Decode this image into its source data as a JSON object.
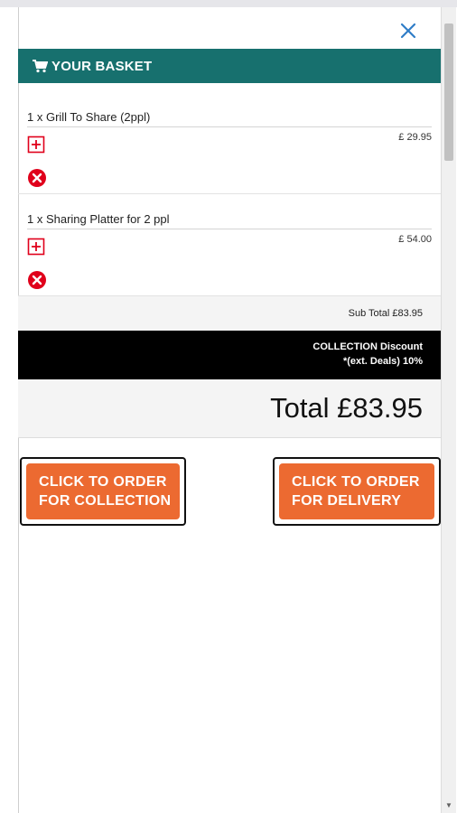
{
  "header": {
    "title": "YOUR BASKET",
    "cart_icon": "cart-icon",
    "close_icon": "close-icon"
  },
  "items": [
    {
      "name": "1 x Grill To Share (2ppl)",
      "price": "£ 29.95"
    },
    {
      "name": "1 x Sharing Platter for 2 ppl",
      "price": "£ 54.00"
    }
  ],
  "summary": {
    "subtotal": "Sub Total £83.95",
    "discount_line1": "COLLECTION Discount",
    "discount_line2": "*(ext. Deals) 10%",
    "total": "Total £83.95"
  },
  "buttons": {
    "collection_line1": "CLICK TO ORDER",
    "collection_line2": "FOR COLLECTION",
    "delivery_line1": "CLICK TO ORDER",
    "delivery_line2": "FOR DELIVERY"
  },
  "colors": {
    "header_bg": "#17706e",
    "accent_orange": "#ec6a31",
    "remove_red": "#e0001b",
    "close_blue": "#2f7dc7"
  }
}
